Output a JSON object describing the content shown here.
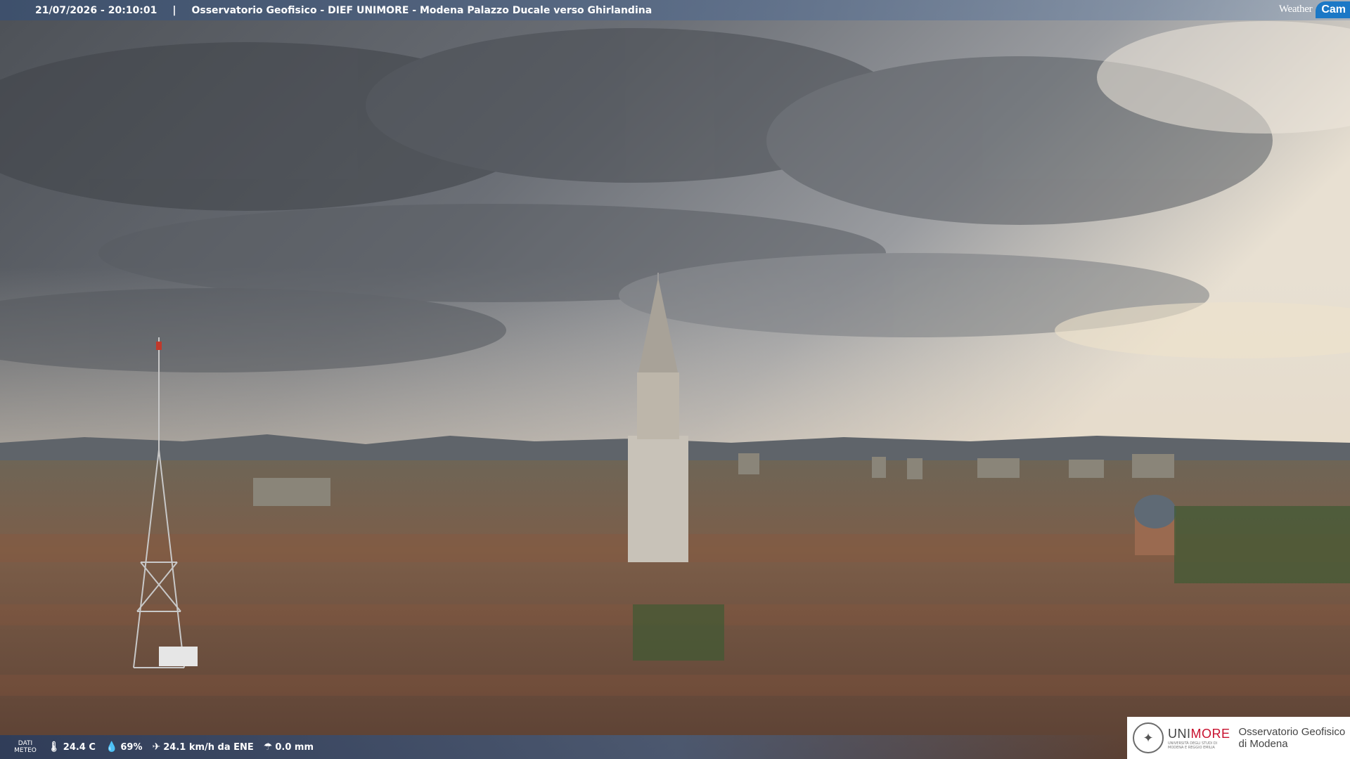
{
  "header": {
    "timestamp": "21/07/2026 - 20:10:01",
    "separator": "|",
    "title": "Osservatorio Geofisico - DIEF UNIMORE - Modena Palazzo Ducale verso Ghirlandina"
  },
  "logo": {
    "weather": "Weather",
    "cam": "Cam"
  },
  "meteo": {
    "label_line1": "DATI",
    "label_line2": "METEO",
    "temperature": "24.4 C",
    "humidity": "69%",
    "wind": "24.1 km/h da ENE",
    "rain": "0.0 mm"
  },
  "unimore": {
    "brand_uni": "UNI",
    "brand_more": "MORE",
    "university_line1": "UNIVERSITÀ DEGLI STUDI DI",
    "university_line2": "MODENA E REGGIO EMILIA",
    "observatory_line1": "Osservatorio Geofisico",
    "observatory_line2": "di Modena"
  },
  "colors": {
    "cam_badge": "#1b78c6",
    "unimore_red": "#c8102e"
  },
  "icons": [
    "thermometer-icon",
    "humidity-drop-icon",
    "wind-icon",
    "rain-gauge-icon"
  ]
}
